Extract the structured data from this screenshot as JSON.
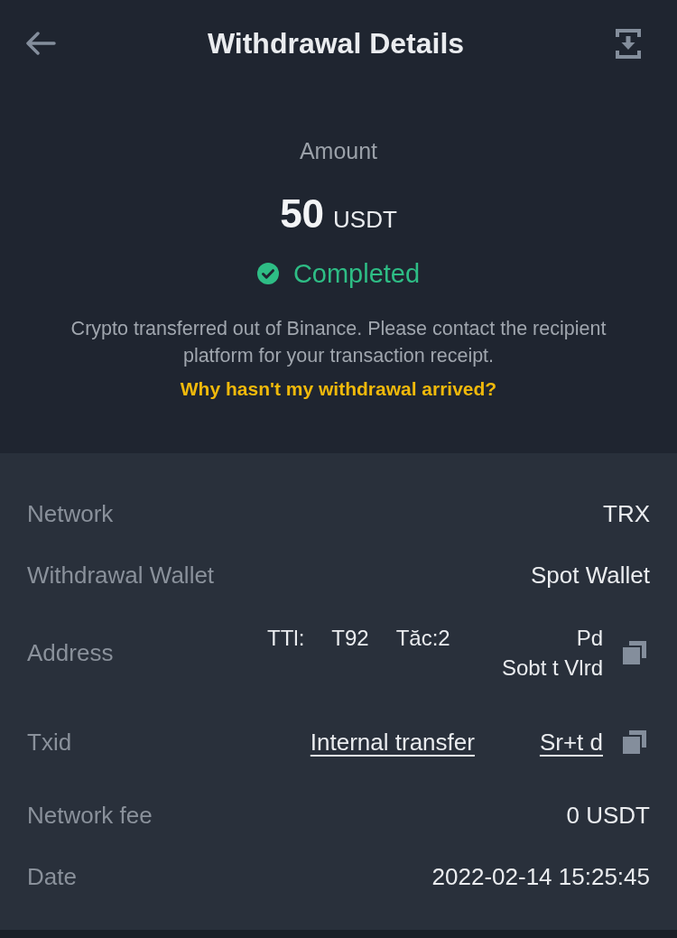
{
  "header": {
    "title": "Withdrawal Details"
  },
  "summary": {
    "amount_label": "Amount",
    "amount": "50",
    "currency": "USDT",
    "status": {
      "kind": "completed",
      "label": "Completed"
    },
    "note": "Crypto transferred out of Binance. Please contact the recipient platform for your transaction receipt.",
    "help_link": "Why hasn't my withdrawal arrived?"
  },
  "details": [
    {
      "kind": "text",
      "label": "Network",
      "value": "TRX"
    },
    {
      "kind": "text",
      "label": "Withdrawal Wallet",
      "value": "Spot Wallet"
    },
    {
      "kind": "address",
      "label": "Address",
      "lines": [
        [
          "TTl:",
          "T92",
          "Tăc:2",
          "Pd"
        ],
        [
          "Sobt t Vlrd"
        ]
      ],
      "copyable": true
    },
    {
      "kind": "txid",
      "label": "Txid",
      "link": "Internal transfer",
      "value": "Sr+t d",
      "copyable": true
    },
    {
      "kind": "text",
      "label": "Network fee",
      "value": "0 USDT"
    },
    {
      "kind": "text",
      "label": "Date",
      "value": "2022-02-14 15:25:45"
    }
  ]
}
